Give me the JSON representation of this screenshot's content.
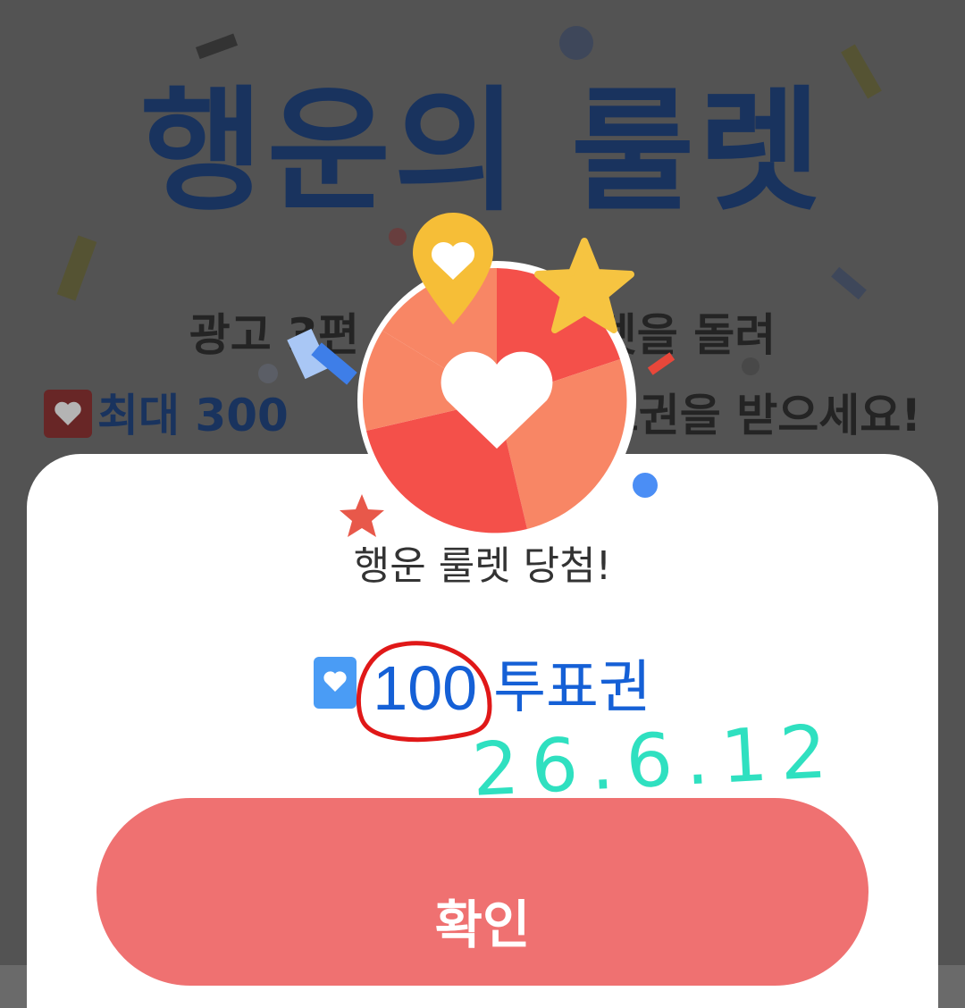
{
  "background": {
    "title": "행운의 룰렛",
    "subtitle_line1": "광고 3편 시청하고 룰렛을 돌려",
    "subtitle_line2_accent": "최대 300",
    "subtitle_line2_rest": "투표권을 받으세요!",
    "title_color": "#123a7c"
  },
  "popup": {
    "title": "행운 룰렛 당첨!",
    "reward_amount": "100",
    "reward_unit": "투표권",
    "confirm_label": "확인",
    "accent_color": "#1560d6",
    "button_color": "#ef7171"
  },
  "handwriting": {
    "date_text": "26.6.12",
    "date_color": "#2fe0c0",
    "circle_color": "#e01818"
  },
  "icons": [
    "heart-icon",
    "wheel-icon",
    "star-icon",
    "pin-icon"
  ]
}
